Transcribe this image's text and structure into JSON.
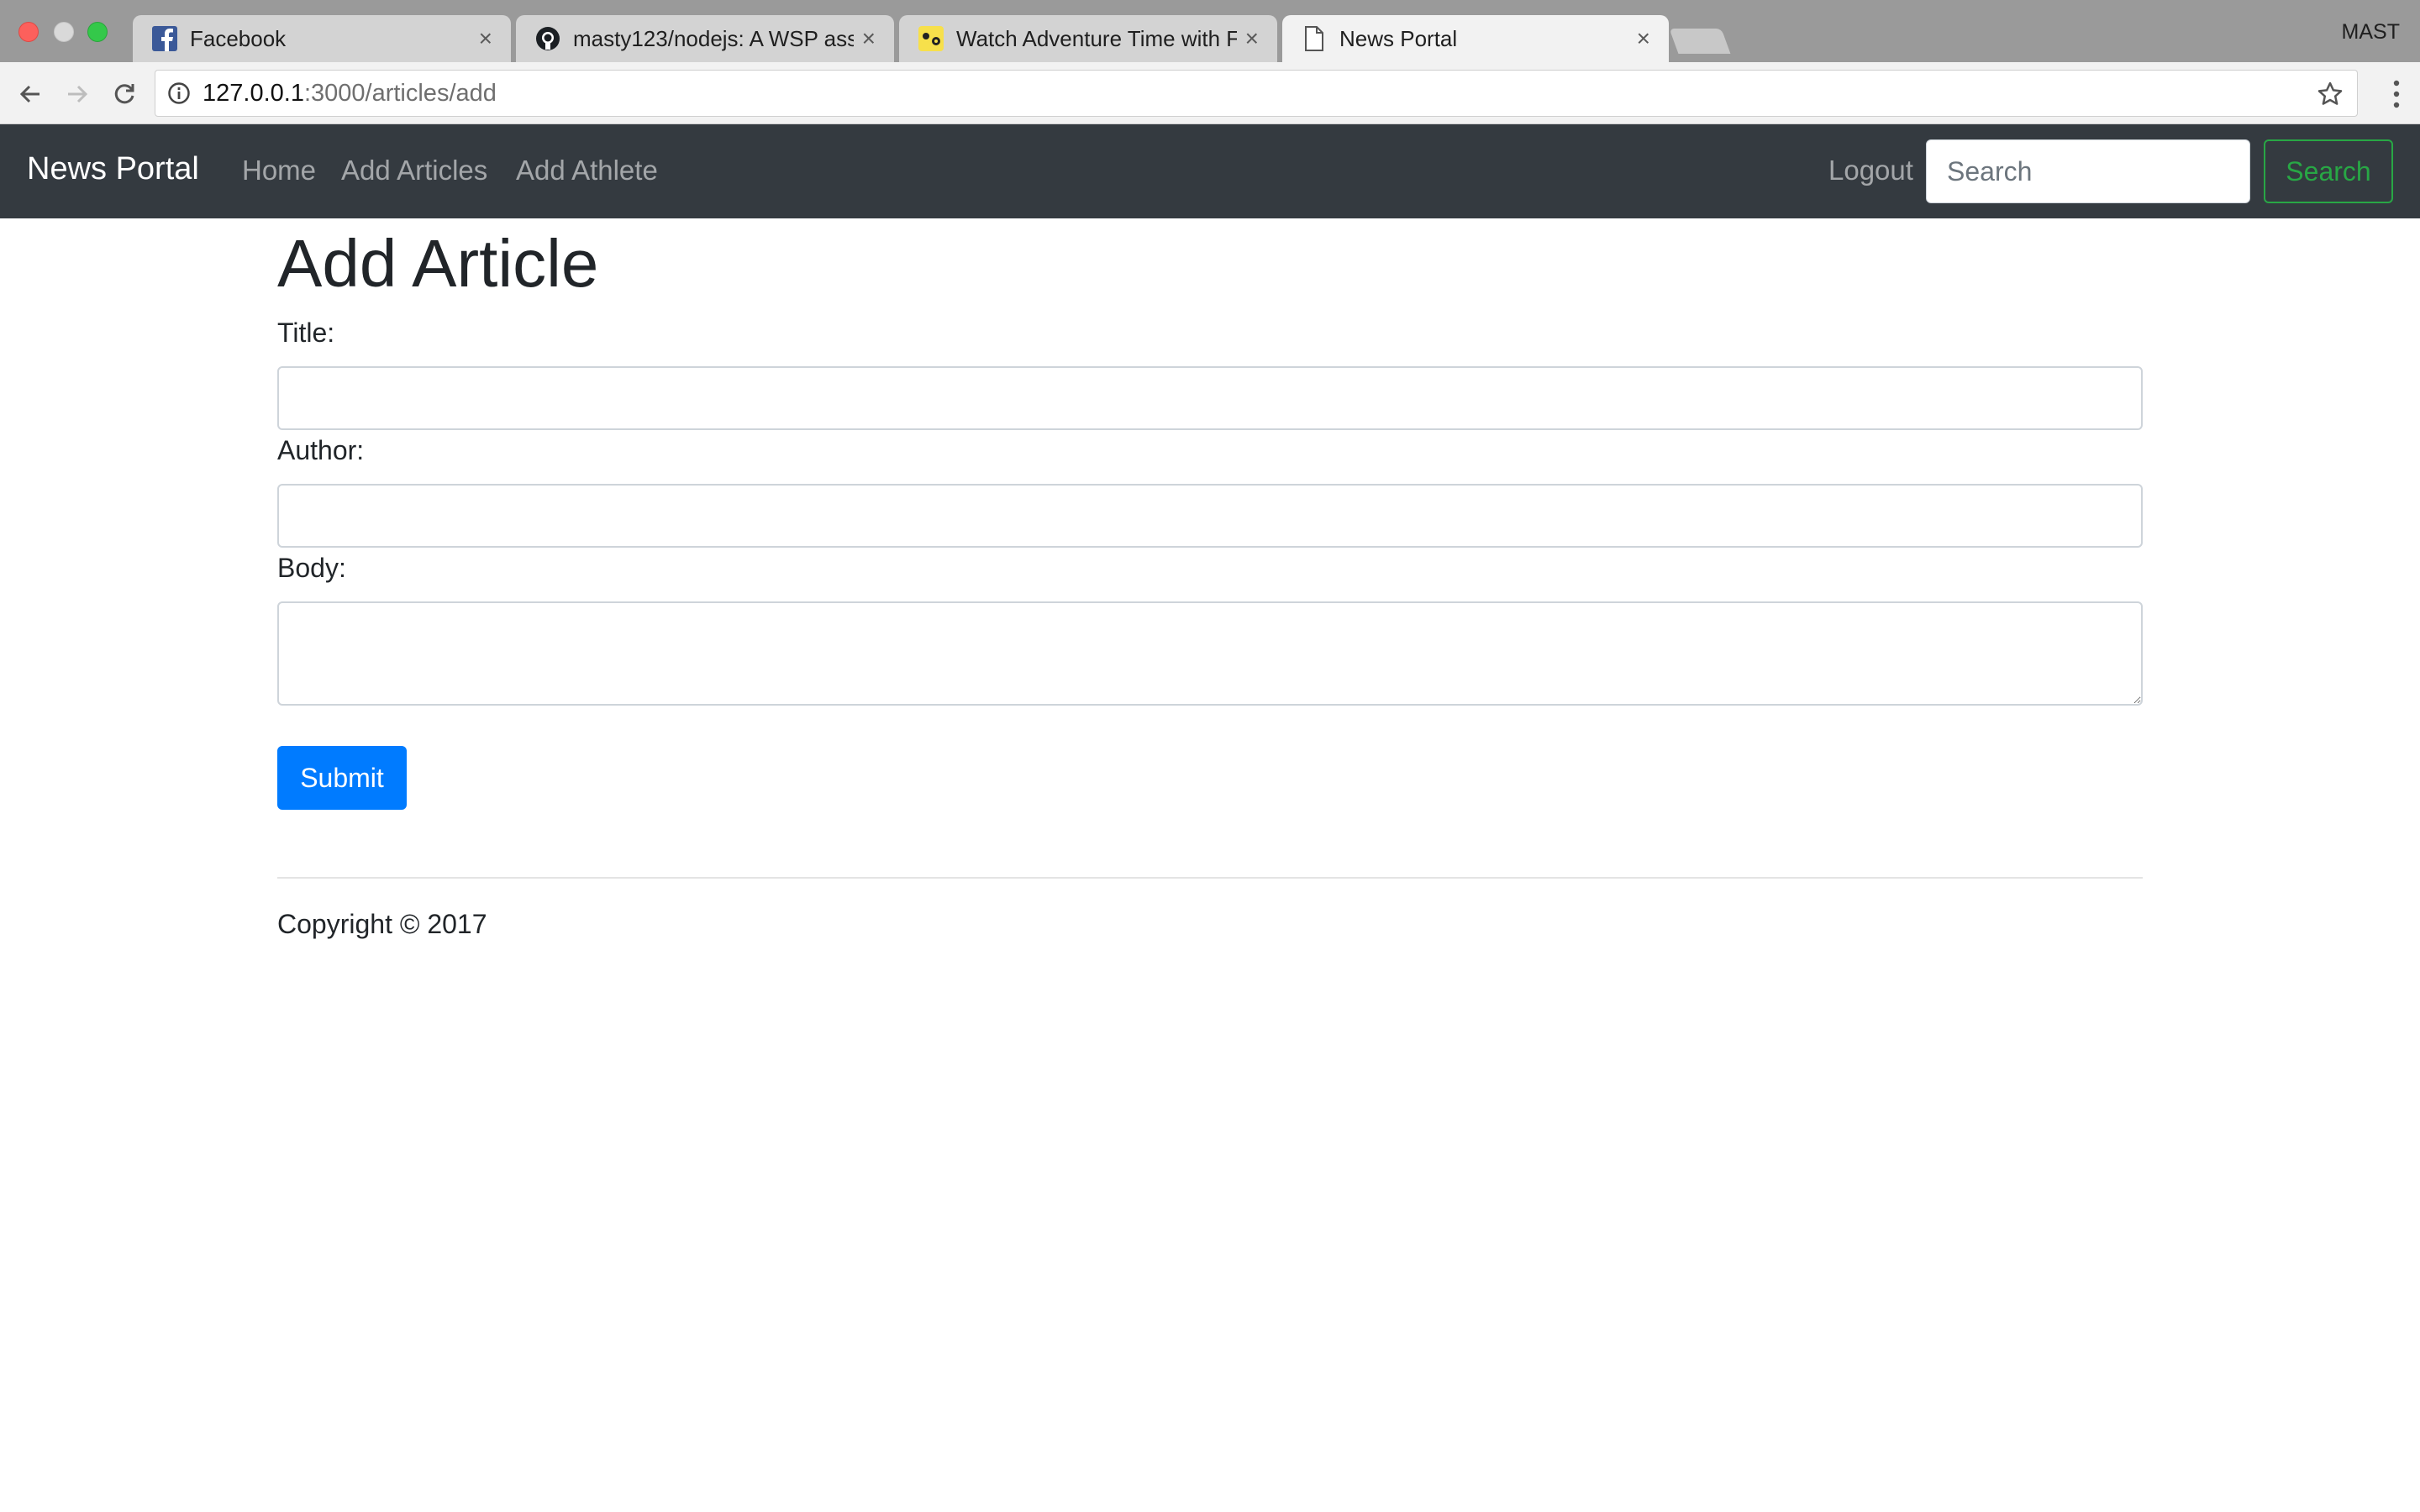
{
  "browser": {
    "tabs": [
      {
        "title": "Facebook",
        "icon": "facebook-icon",
        "active": false
      },
      {
        "title": "masty123/nodejs: A WSP assig",
        "icon": "github-icon",
        "active": false
      },
      {
        "title": "Watch Adventure Time with Fir",
        "icon": "adventure-time-icon",
        "active": false
      },
      {
        "title": "News Portal",
        "icon": "page-icon",
        "active": true
      }
    ],
    "tab_close": "×",
    "profile": "MAST",
    "url_host": "127.0.0.1",
    "url_path": ":3000/articles/add"
  },
  "navbar": {
    "brand": "News Portal",
    "links": [
      "Home",
      "Add Articles",
      "Add Athlete"
    ],
    "logout": "Logout",
    "search_placeholder": "Search",
    "search_button": "Search"
  },
  "form": {
    "heading": "Add Article",
    "title_label": "Title:",
    "title_value": "",
    "author_label": "Author:",
    "author_value": "",
    "body_label": "Body:",
    "body_value": "",
    "submit_label": "Submit"
  },
  "footer": {
    "copyright": "Copyright © 2017"
  },
  "colors": {
    "navbar_bg": "#343a40",
    "primary": "#007bff",
    "success": "#28a745"
  }
}
